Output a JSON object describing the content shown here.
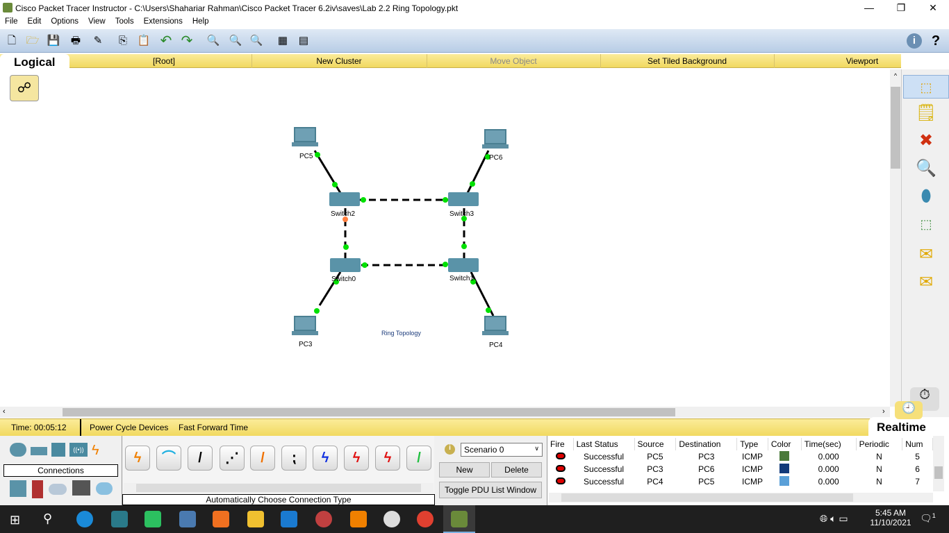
{
  "window": {
    "title": "Cisco Packet Tracer Instructor - C:\\Users\\Shahariar Rahman\\Cisco Packet Tracer 6.2iv\\saves\\Lab 2.2 Ring Topology.pkt",
    "minimize": "—",
    "restore": "❐",
    "close": "✕"
  },
  "menu": [
    "File",
    "Edit",
    "Options",
    "View",
    "Tools",
    "Extensions",
    "Help"
  ],
  "toolbar": {
    "icons": [
      "new-icon",
      "open-icon",
      "save-icon",
      "print-icon",
      "activity-wizard-icon",
      "copy-icon",
      "paste-icon",
      "undo-icon",
      "redo-icon",
      "zoom-in-icon",
      "zoom-reset-icon",
      "zoom-out-icon",
      "palette-icon",
      "custom-device-icon"
    ],
    "help": "i",
    "question": "?"
  },
  "logical_bar": {
    "tab": "Logical",
    "root": "[Root]",
    "new_cluster": "New Cluster",
    "move_object": "Move Object",
    "tiled_bg": "Set Tiled Background",
    "viewport": "Viewport"
  },
  "topology": {
    "devices": [
      {
        "name": "PC5",
        "type": "pc"
      },
      {
        "name": "PC6",
        "type": "pc"
      },
      {
        "name": "Switch2",
        "type": "switch"
      },
      {
        "name": "Switch3",
        "type": "switch"
      },
      {
        "name": "Switch0",
        "type": "switch"
      },
      {
        "name": "Switch1",
        "type": "switch"
      },
      {
        "name": "PC3",
        "type": "pc"
      },
      {
        "name": "PC4",
        "type": "pc"
      }
    ],
    "note": "Ring Topology",
    "link_status_colors": {
      "up": "#00e000",
      "blocking": "#ff7f3f"
    }
  },
  "status": {
    "time": "Time: 00:05:12",
    "power_cycle": "Power Cycle Devices",
    "fast_forward": "Fast Forward Time",
    "mode": "Realtime"
  },
  "devices_panel": {
    "category": "Connections",
    "connection_type": "Automatically Choose Connection Type"
  },
  "scenario": {
    "selected": "Scenario 0",
    "new": "New",
    "delete": "Delete",
    "toggle": "Toggle PDU List Window"
  },
  "pdu_table": {
    "headers": [
      "Fire",
      "Last Status",
      "Source",
      "Destination",
      "Type",
      "Color",
      "Time(sec)",
      "Periodic",
      "Num"
    ],
    "rows": [
      {
        "status": "Successful",
        "source": "PC5",
        "destination": "PC3",
        "type": "ICMP",
        "color": "#4a7a3a",
        "time": "0.000",
        "periodic": "N",
        "num": "5"
      },
      {
        "status": "Successful",
        "source": "PC3",
        "destination": "PC6",
        "type": "ICMP",
        "color": "#123a7a",
        "time": "0.000",
        "periodic": "N",
        "num": "6"
      },
      {
        "status": "Successful",
        "source": "PC4",
        "destination": "PC5",
        "type": "ICMP",
        "color": "#5aa0d8",
        "time": "0.000",
        "periodic": "N",
        "num": "7"
      }
    ]
  },
  "taskbar": {
    "time": "5:45 AM",
    "date": "11/10/2021",
    "notifications": "1"
  }
}
